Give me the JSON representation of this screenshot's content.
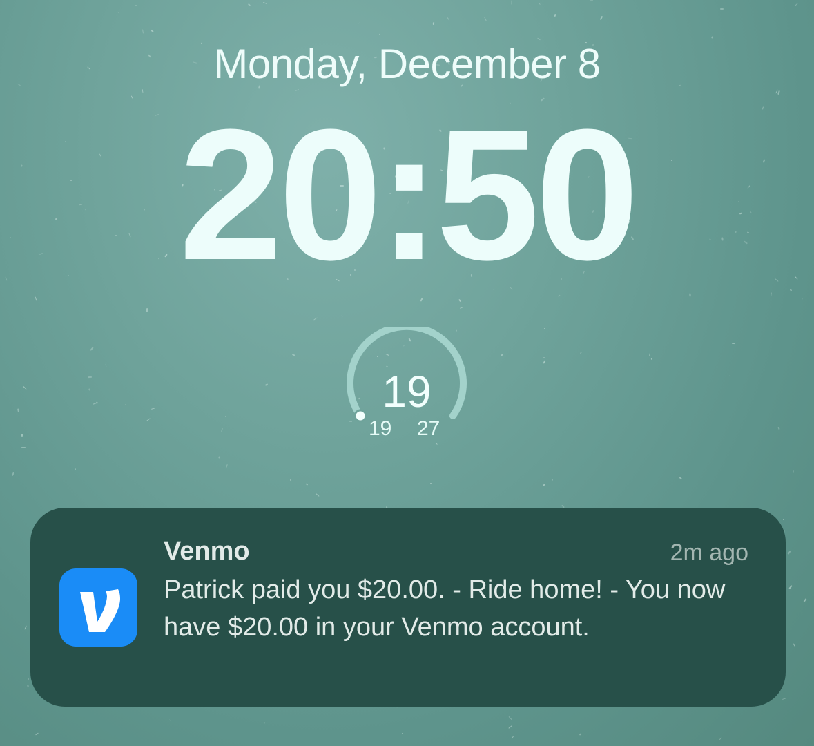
{
  "lockscreen": {
    "date": "Monday, December 8",
    "time": "20:50"
  },
  "widget": {
    "type": "temperature-gauge",
    "current": "19",
    "low": "19",
    "high": "27",
    "level": 0
  },
  "notification": {
    "app_name": "Venmo",
    "app_icon": "venmo-v-icon",
    "timestamp": "2m ago",
    "message": "Patrick paid you $20.00. - Ride home! - You now have $20.00 in your Venmo account.",
    "icon_color": "#1a8cf7",
    "background_color": "#275049"
  },
  "colors": {
    "wallpaper": "#6fa39b",
    "text": "#edfdfb"
  }
}
